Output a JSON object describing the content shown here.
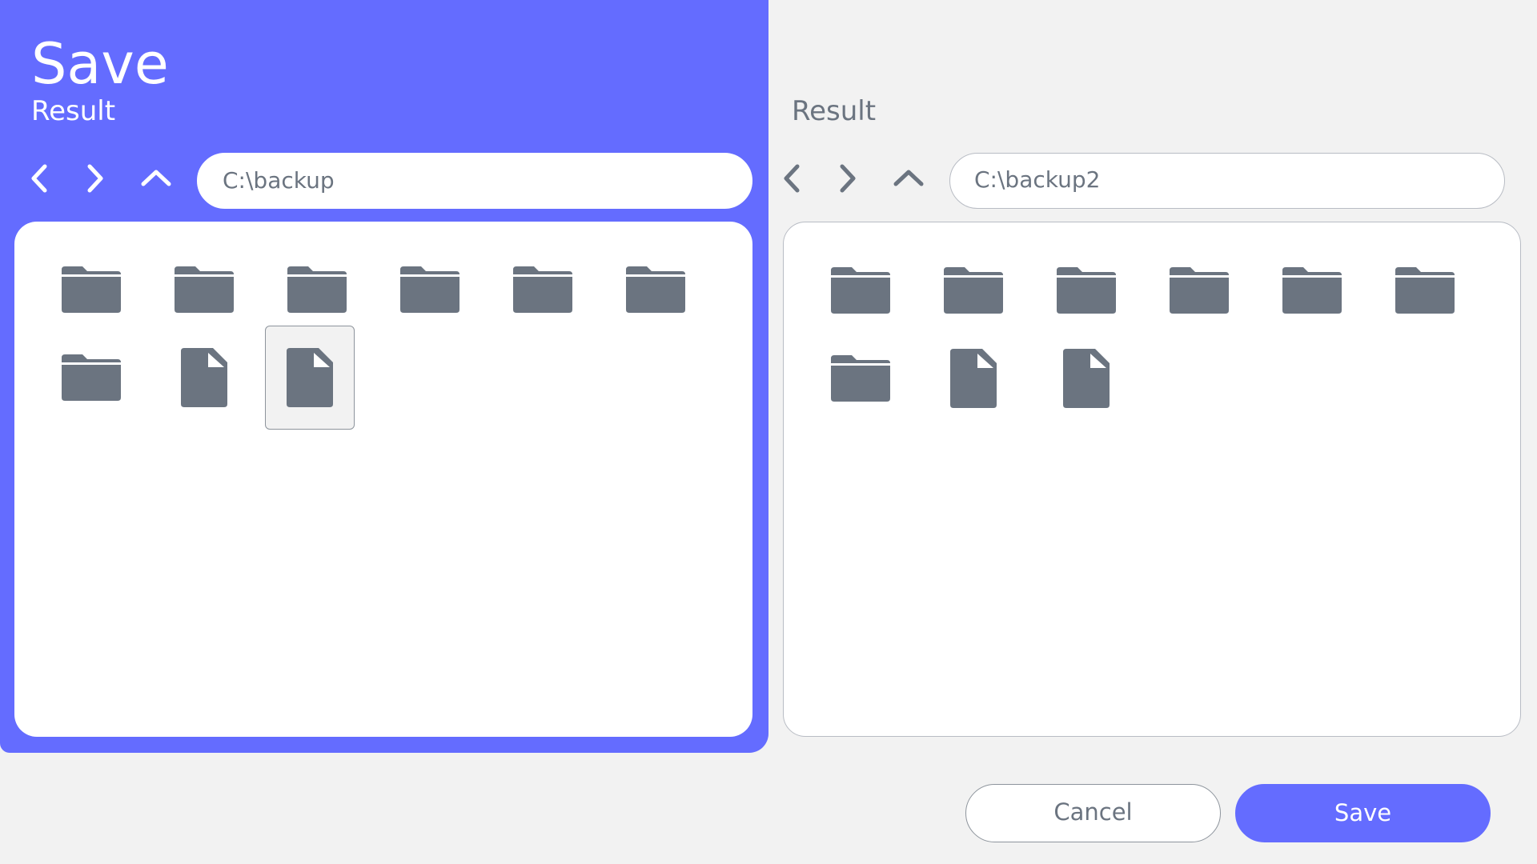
{
  "dialog": {
    "title": "Save",
    "colors": {
      "accent": "#646cff",
      "icon": "#6b7480",
      "background": "#f2f2f2",
      "panel": "#ffffff"
    }
  },
  "left_pane": {
    "subtitle": "Result",
    "path": "C:\\backup",
    "items": [
      {
        "type": "folder-icon"
      },
      {
        "type": "folder-icon"
      },
      {
        "type": "folder-icon"
      },
      {
        "type": "folder-icon"
      },
      {
        "type": "folder-icon"
      },
      {
        "type": "folder-icon"
      },
      {
        "type": "folder-icon"
      },
      {
        "type": "file-icon"
      },
      {
        "type": "file-icon",
        "selected": true
      }
    ]
  },
  "right_pane": {
    "subtitle": "Result",
    "path": "C:\\backup2",
    "items": [
      {
        "type": "folder-icon"
      },
      {
        "type": "folder-icon"
      },
      {
        "type": "folder-icon"
      },
      {
        "type": "folder-icon"
      },
      {
        "type": "folder-icon"
      },
      {
        "type": "folder-icon"
      },
      {
        "type": "folder-icon"
      },
      {
        "type": "file-icon"
      },
      {
        "type": "file-icon"
      }
    ]
  },
  "nav_icons": {
    "back": "chevron-left-icon",
    "forward": "chevron-right-icon",
    "up": "chevron-up-icon"
  },
  "actions": {
    "cancel_label": "Cancel",
    "save_label": "Save"
  }
}
